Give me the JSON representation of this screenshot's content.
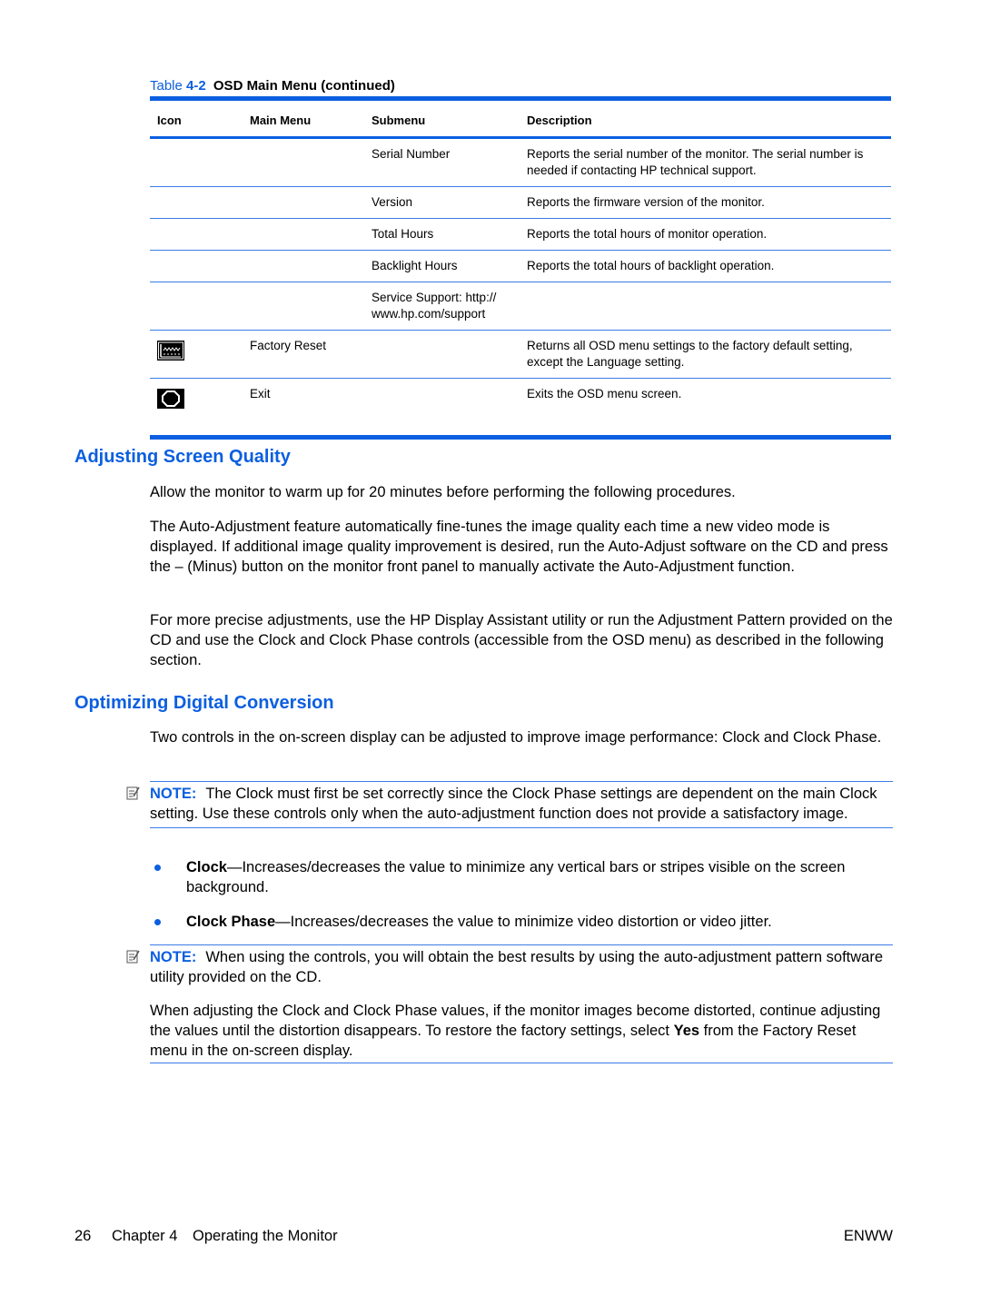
{
  "table": {
    "caption_prefix": "Table ",
    "caption_number": "4-2",
    "caption_title": "OSD Main Menu (continued)",
    "headers": [
      "Icon",
      "Main Menu",
      "Submenu",
      "Description"
    ],
    "rows": [
      {
        "icon": "",
        "main": "",
        "sub": "Serial Number",
        "desc": "Reports the serial number of the monitor. The serial number is needed if contacting HP technical support."
      },
      {
        "icon": "",
        "main": "",
        "sub": "Version",
        "desc": "Reports the firmware version of the monitor."
      },
      {
        "icon": "",
        "main": "",
        "sub": "Total Hours",
        "desc": "Reports the total hours of monitor operation."
      },
      {
        "icon": "",
        "main": "",
        "sub": "Backlight Hours",
        "desc": "Reports the total hours of backlight operation."
      },
      {
        "icon": "",
        "main": "",
        "sub": "Service Support: http:// www.hp.com/support",
        "desc": ""
      },
      {
        "icon": "factory-reset-icon",
        "main": "Factory Reset",
        "sub": "",
        "desc": "Returns all OSD menu settings to the factory default setting, except the Language setting."
      },
      {
        "icon": "exit-icon",
        "main": "Exit",
        "sub": "",
        "desc": "Exits the OSD menu screen."
      }
    ]
  },
  "sections": {
    "adjusting": {
      "title": "Adjusting Screen Quality",
      "p1": "Allow the monitor to warm up for 20 minutes before performing the following procedures.",
      "p2": "The Auto-Adjustment feature automatically fine-tunes the image quality each time a new video mode is displayed. If additional image quality improvement is desired, run the Auto-Adjust software on the CD and press the – (Minus) button on the monitor front panel to manually activate the Auto-Adjustment function.",
      "p3": "For more precise adjustments, use the HP Display Assistant utility or run the Adjustment Pattern provided on the CD and use the Clock and Clock Phase controls (accessible from the OSD menu) as described in the following section."
    },
    "optimizing": {
      "title": "Optimizing Digital Conversion",
      "p1": "Two controls in the on-screen display can be adjusted to improve image performance: Clock and Clock Phase.",
      "note1_label": "NOTE:",
      "note1_text": "The Clock must first be set correctly since the Clock Phase settings are dependent on the main Clock setting. Use these controls only when the auto-adjustment function does not provide a satisfactory image.",
      "bullets": [
        {
          "term": "Clock",
          "text": "—Increases/decreases the value to minimize any vertical bars or stripes visible on the screen background."
        },
        {
          "term": "Clock Phase",
          "text": "—Increases/decreases the value to minimize video distortion or video jitter."
        }
      ],
      "note2_label": "NOTE:",
      "note2_text": "When using the controls, you will obtain the best results by using the auto-adjustment pattern software utility provided on the CD.",
      "p2_before": "When adjusting the Clock and Clock Phase values, if the monitor images become distorted, continue adjusting the values until the distortion disappears. To restore the factory settings, select ",
      "p2_bold": "Yes",
      "p2_after": " from the Factory Reset menu in the on-screen display."
    }
  },
  "footer": {
    "page_number": "26",
    "chapter": "Chapter 4",
    "chapter_title": "Operating the Monitor",
    "right": "ENWW"
  }
}
